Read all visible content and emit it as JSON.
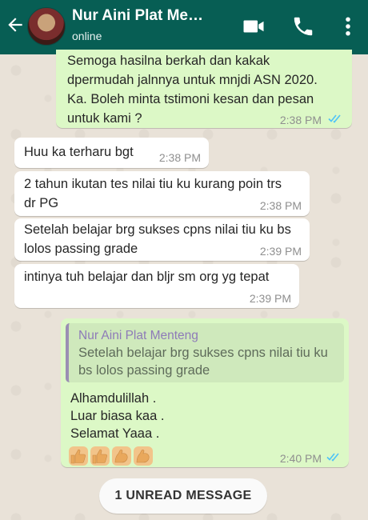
{
  "header": {
    "contact_name": "Nur Aini Plat Me…",
    "status": "online",
    "colors": {
      "bar": "#075e54",
      "outgoing": "#dcf8c6",
      "incoming": "#ffffff",
      "read_ticks": "#4fc3f7"
    }
  },
  "messages": {
    "out1": {
      "lines": [
        "Semoga hasilna berkah dan kakak",
        "dpermudah jalnnya untuk mnjdi ASN 2020.",
        "Ka. Boleh minta tstimoni kesan dan pesan",
        "untuk kami ?"
      ],
      "time": "2:38 PM"
    },
    "in1": {
      "text": "Huu ka terharu bgt",
      "time": "2:38 PM"
    },
    "in2": {
      "text": "2 tahun ikutan tes nilai tiu ku kurang poin trs dr PG",
      "time": "2:38 PM"
    },
    "in3": {
      "text": "Setelah belajar brg sukses cpns nilai tiu ku bs lolos passing grade",
      "time": "2:39 PM"
    },
    "in4": {
      "text": "intinya tuh belajar dan bljr sm org yg tepat",
      "time": "2:39 PM"
    },
    "out2": {
      "quote_name": "Nur Aini Plat Menteng",
      "quote_text": "Setelah belajar brg sukses cpns nilai tiu ku bs lolos passing grade",
      "lines": [
        "Alhamdulillah .",
        "Luar biasa kaa .",
        "Selamat Yaaa ."
      ],
      "emoji_icons": [
        "thumbs-up",
        "thumbs-up",
        "flexed-biceps",
        "flexed-biceps"
      ],
      "time": "2:40 PM"
    }
  },
  "unread_banner": "1 UNREAD MESSAGE"
}
